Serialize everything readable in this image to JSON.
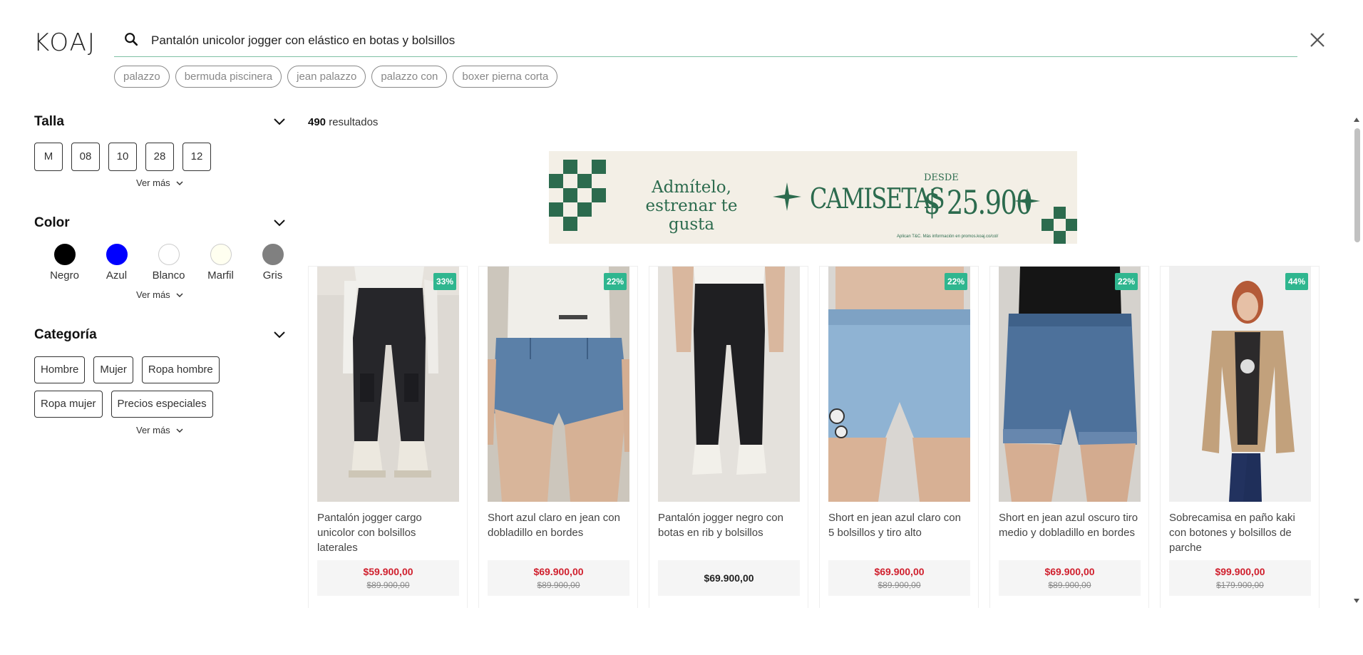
{
  "brand": {
    "logo": "KOAJ"
  },
  "search": {
    "value": "Pantalón unicolor jogger con elástico en botas y bolsillos",
    "suggestions": [
      "palazzo",
      "bermuda piscinera",
      "jean palazzo",
      "palazzo con",
      "boxer pierna corta"
    ]
  },
  "filters": {
    "talla": {
      "title": "Talla",
      "options": [
        "M",
        "08",
        "10",
        "28",
        "12"
      ],
      "more": "Ver más"
    },
    "color": {
      "title": "Color",
      "options": [
        {
          "label": "Negro",
          "hex": "#000000"
        },
        {
          "label": "Azul",
          "hex": "#0000ff"
        },
        {
          "label": "Blanco",
          "hex": "#ffffff"
        },
        {
          "label": "Marfil",
          "hex": "#fffff0"
        },
        {
          "label": "Gris",
          "hex": "#808080"
        }
      ],
      "more": "Ver más"
    },
    "categoria": {
      "title": "Categoría",
      "options": [
        "Hombre",
        "Mujer",
        "Ropa hombre",
        "Ropa mujer",
        "Precios especiales"
      ],
      "more": "Ver más"
    }
  },
  "results": {
    "count": "490",
    "label": "resultados"
  },
  "banner": {
    "line1": "Admítelo,",
    "line2": "estrenar te gusta",
    "headline": "CAMISETAS",
    "prefix": "DESDE",
    "price": "$ 25.900",
    "legal": "Aplican T&C. Más información en promos.koaj.co/col/"
  },
  "products": [
    {
      "name": "Pantalón jogger cargo unicolor con bolsillos laterales",
      "price": "$59.900,00",
      "old_price": "$89.900,00",
      "badge": "33%"
    },
    {
      "name": "Short azul claro en jean con dobladillo en bordes",
      "price": "$69.900,00",
      "old_price": "$89.900,00",
      "badge": "22%"
    },
    {
      "name": "Pantalón jogger negro con botas en rib y bolsillos",
      "price": "$69.900,00",
      "old_price": "",
      "badge": ""
    },
    {
      "name": "Short en jean azul claro con 5 bolsillos y tiro alto",
      "price": "$69.900,00",
      "old_price": "$89.900,00",
      "badge": "22%"
    },
    {
      "name": "Short en jean azul oscuro tiro medio y dobladillo en bordes",
      "price": "$69.900,00",
      "old_price": "$89.900,00",
      "badge": "22%"
    },
    {
      "name": "Sobrecamisa en paño kaki con botones y bolsillos de parche",
      "price": "$99.900,00",
      "old_price": "$179.900,00",
      "badge": "44%"
    }
  ],
  "colors": {
    "accent": "#2fb68f",
    "sale_price": "#d0202e",
    "banner_green": "#2c6b4e",
    "search_underline": "#7fc1a4"
  }
}
